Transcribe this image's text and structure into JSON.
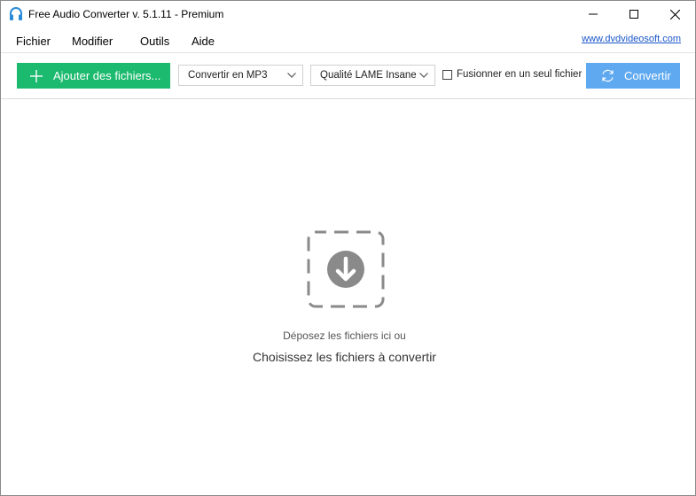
{
  "window": {
    "title": "Free Audio Converter v. 5.1.11 - Premium"
  },
  "menu": {
    "items": [
      "Fichier",
      "Modifier",
      "Outils",
      "Aide"
    ],
    "link": "www.dvdvideosoft.com"
  },
  "toolbar": {
    "add_label": "Ajouter des fichiers...",
    "format_selected": "Convertir en MP3",
    "quality_selected": "Qualité LAME Insane",
    "merge_label": "Fusionner en un seul fichier",
    "merge_checked": false,
    "convert_label": "Convertir"
  },
  "dropzone": {
    "line1": "Déposez les fichiers ici ou",
    "line2": "Choisissez les fichiers à convertir"
  },
  "colors": {
    "add_button": "#1cba6e",
    "convert_button": "#5fa9f0",
    "link": "#1a56c9",
    "drop_icon": "#8a8a8a"
  },
  "icons": {
    "app": "headphones-icon",
    "minimize": "minimize-icon",
    "maximize": "maximize-icon",
    "close": "close-icon",
    "add": "plus-icon",
    "dropdown": "chevron-down-icon",
    "convert": "refresh-icon",
    "drop": "download-arrow-icon"
  }
}
